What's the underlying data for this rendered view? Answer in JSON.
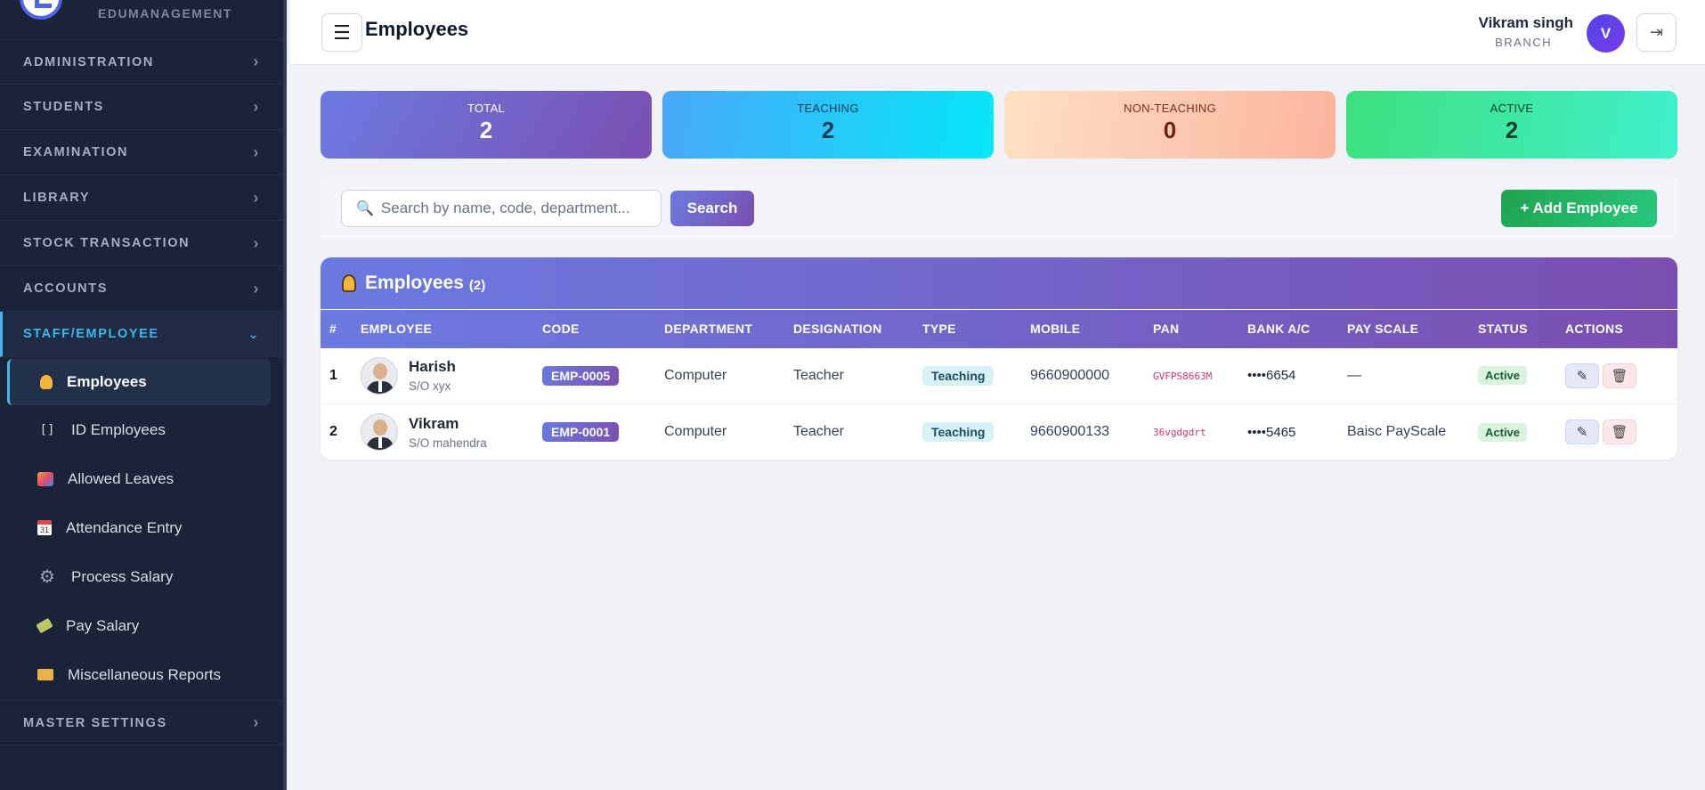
{
  "brand": {
    "name": "EDUMANAGEMENT"
  },
  "sidebar": {
    "sections": [
      {
        "label": "ADMINISTRATION"
      },
      {
        "label": "STUDENTS"
      },
      {
        "label": "EXAMINATION"
      },
      {
        "label": "LIBRARY"
      },
      {
        "label": "STOCK TRANSACTION"
      },
      {
        "label": "ACCOUNTS"
      },
      {
        "label": "STAFF/EMPLOYEE",
        "expanded": true
      }
    ],
    "sub_items": [
      {
        "label": "Employees",
        "icon": "employee-icon",
        "active": true
      },
      {
        "label": "ID Employees",
        "icon": "id-card-icon"
      },
      {
        "label": "Allowed Leaves",
        "icon": "picture-icon"
      },
      {
        "label": "Attendance Entry",
        "icon": "calendar-icon"
      },
      {
        "label": "Process Salary",
        "icon": "gear-icon"
      },
      {
        "label": "Pay Salary",
        "icon": "money-icon"
      },
      {
        "label": "Miscellaneous Reports",
        "icon": "folder-icon"
      }
    ],
    "master": {
      "label": "MASTER SETTINGS"
    }
  },
  "header": {
    "title": "Employees",
    "user_name": "Vikram singh",
    "user_role": "BRANCH",
    "avatar_letter": "V"
  },
  "stats": {
    "total": {
      "label": "TOTAL",
      "value": "2"
    },
    "teaching": {
      "label": "TEACHING",
      "value": "2"
    },
    "non_teaching": {
      "label": "NON-TEACHING",
      "value": "0"
    },
    "active": {
      "label": "ACTIVE",
      "value": "2"
    }
  },
  "search": {
    "placeholder": "Search by name, code, department...",
    "button_label": "Search",
    "add_label": "+ Add Employee"
  },
  "table": {
    "title": "Employees",
    "count": "(2)",
    "columns": [
      "#",
      "EMPLOYEE",
      "CODE",
      "DEPARTMENT",
      "DESIGNATION",
      "TYPE",
      "MOBILE",
      "PAN",
      "BANK A/C",
      "PAY SCALE",
      "STATUS",
      "ACTIONS"
    ],
    "rows": [
      {
        "num": "1",
        "name": "Harish",
        "relation": "S/O xyx",
        "code": "EMP-0005",
        "department": "Computer",
        "designation": "Teacher",
        "type": "Teaching",
        "mobile": "9660900000",
        "pan": "GVFPS8663M",
        "bank": "••••6654",
        "pay_scale": "—",
        "status": "Active"
      },
      {
        "num": "2",
        "name": "Vikram",
        "relation": "S/O mahendra",
        "code": "EMP-0001",
        "department": "Computer",
        "designation": "Teacher",
        "type": "Teaching",
        "mobile": "9660900133",
        "pan": "36vgdgdrt",
        "bank": "••••5465",
        "pay_scale": "Baisc PayScale",
        "status": "Active"
      }
    ]
  },
  "colors": {
    "sidebar_bg": "#1b2338",
    "accent": "#3db8e8",
    "primary_gradient_start": "#6b7ae0",
    "primary_gradient_end": "#7a4fb0",
    "success": "#1fa34f"
  }
}
